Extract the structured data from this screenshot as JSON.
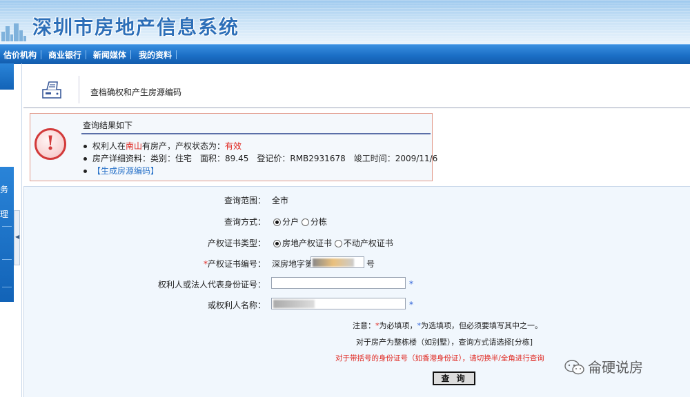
{
  "app": {
    "title": "深圳市房地产信息系统"
  },
  "nav": {
    "items": [
      "估价机构",
      "商业银行",
      "新闻媒体",
      "我的资料"
    ]
  },
  "sidebar": {
    "fragments": [
      "务",
      "理"
    ]
  },
  "page": {
    "title": "查档确权和产生房源编码"
  },
  "result": {
    "heading": "查询结果如下",
    "line1": {
      "prefix": "权利人在",
      "district": "南山",
      "middle": "有房产，产权状态为：",
      "status": "有效"
    },
    "line2": "房产详细资料：类别：住宅　面积：89.45　登记价：RMB2931678　竣工时间：2009/11/6",
    "link": "【生成房源编码】",
    "colors": {
      "status": "#e0261f",
      "link": "#2a73c9"
    }
  },
  "form": {
    "scope": {
      "label": "查询范围：",
      "value": "全市"
    },
    "method": {
      "label": "查询方式：",
      "options": [
        "分户",
        "分栋"
      ],
      "selected": "分户"
    },
    "cert_type": {
      "label": "产权证书类型：",
      "options": [
        "房地产权证书",
        "不动产权证书"
      ],
      "selected": "房地产权证书"
    },
    "cert_no": {
      "required_mark": "*",
      "label": "产权证书编号：",
      "prefix": "深房地字第",
      "suffix": "号"
    },
    "id_no": {
      "label": "权利人或法人代表身份证号：",
      "mark": "*"
    },
    "name": {
      "label": "或权利人名称：",
      "mark": "*"
    },
    "notes": {
      "line1_prefix": "注意：",
      "line1_req": "*",
      "line1_mid": "为必填项，",
      "line1_opt": "*",
      "line1_end": "为选填项，但必须要填写其中之一。",
      "line2": "对于房产为整栋楼（如别墅），查询方式请选择[分栋]",
      "line3": "对于带括号的身份证号（如香港身份证），请切换半/全角进行查询"
    },
    "submit_label": "查 询"
  },
  "watermark": {
    "text": "侖硬说房"
  }
}
